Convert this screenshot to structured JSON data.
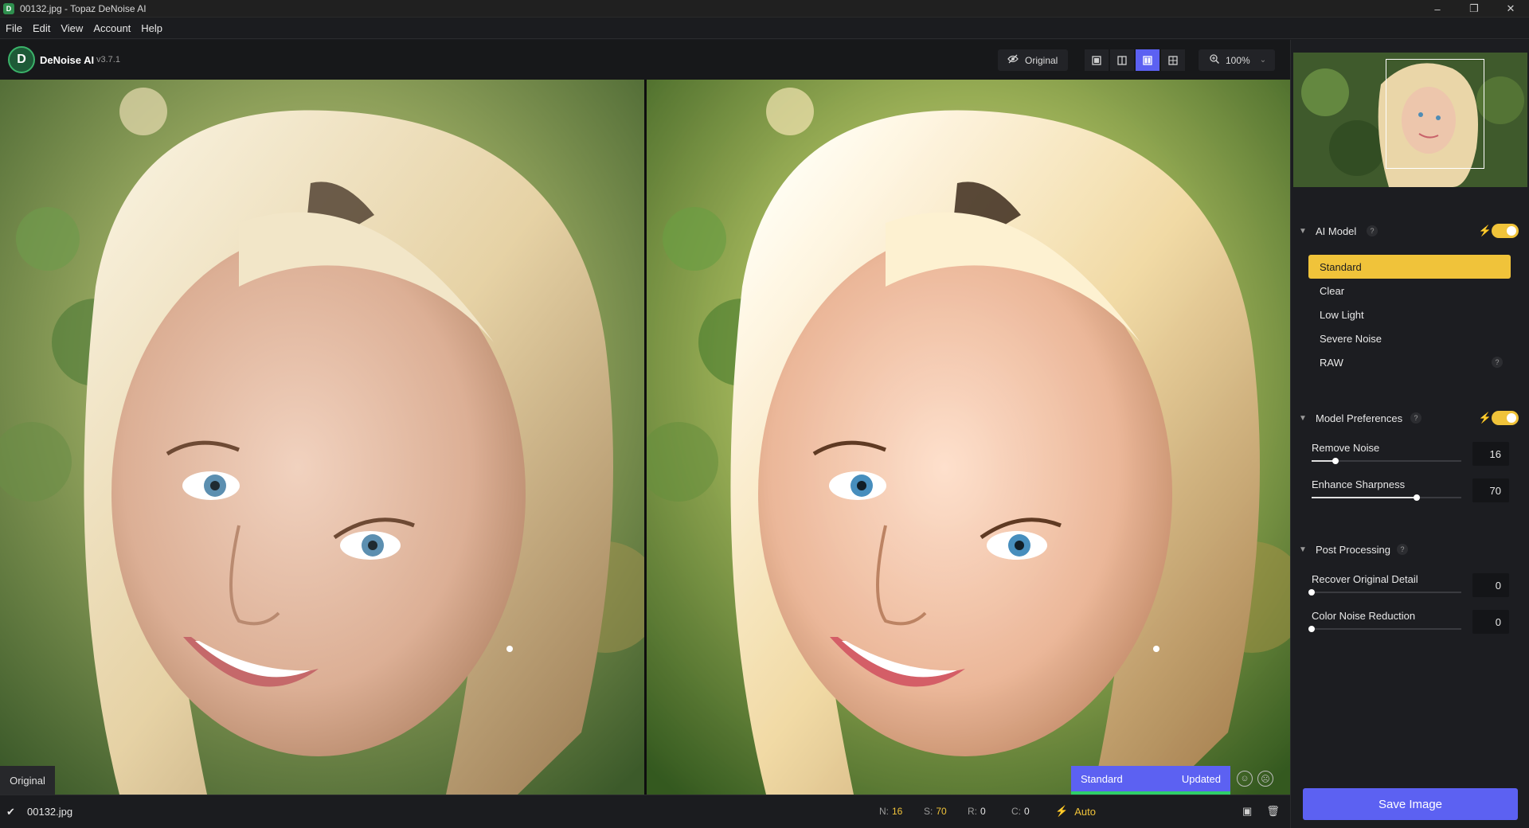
{
  "window": {
    "title": "00132.jpg - Topaz DeNoise AI",
    "app_icon_letter": "D",
    "controls": [
      "–",
      "❐",
      "✕"
    ]
  },
  "menu": [
    "File",
    "Edit",
    "View",
    "Account",
    "Help"
  ],
  "toolbar": {
    "app_name": "DeNoise AI",
    "version": "v3.7.1",
    "logo_letter": "D",
    "original_button": "Original",
    "original_icon": "eye-slash-icon",
    "view_modes": [
      "single-view-icon",
      "split-view-icon",
      "side-by-side-view-icon",
      "quad-view-icon"
    ],
    "active_view_mode": "side-by-side-view-icon",
    "zoom": "100%",
    "zoom_icon": "zoom-in-icon"
  },
  "preview": {
    "left_label": "Original",
    "compare_model": "Standard",
    "compare_status": "Updated",
    "progress_fraction": 1.0
  },
  "statusbar": {
    "filename": "00132.jpg",
    "n_label": "N:",
    "n_value": "16",
    "s_label": "S:",
    "s_value": "70",
    "r_label": "R:",
    "r_value": "0",
    "c_label": "C:",
    "c_value": "0",
    "auto_label": "Auto"
  },
  "sidebar": {
    "ai_model": {
      "title": "AI Model",
      "auto_enabled": true,
      "models": [
        "Standard",
        "Clear",
        "Low Light",
        "Severe Noise",
        "RAW"
      ],
      "selected": "Standard"
    },
    "model_preferences": {
      "title": "Model Preferences",
      "auto_enabled": true,
      "sliders": [
        {
          "label": "Remove Noise",
          "value": "16",
          "fraction": 0.16
        },
        {
          "label": "Enhance Sharpness",
          "value": "70",
          "fraction": 0.7
        }
      ]
    },
    "post_processing": {
      "title": "Post Processing",
      "sliders": [
        {
          "label": "Recover Original Detail",
          "value": "0",
          "fraction": 0.0
        },
        {
          "label": "Color Noise Reduction",
          "value": "0",
          "fraction": 0.0
        }
      ]
    },
    "save_button": "Save Image"
  },
  "colors": {
    "accent": "#5c61f2",
    "auto_yellow": "#f0c33a",
    "progress_green": "#2fcf6a",
    "panel_bg": "#1c1d21"
  }
}
